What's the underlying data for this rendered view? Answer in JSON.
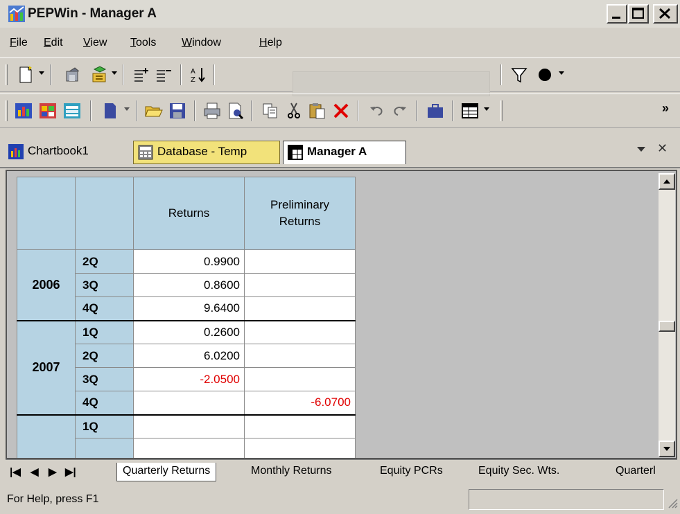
{
  "window": {
    "title": "PEPWin - Manager A",
    "buttons": [
      "minimize",
      "maximize",
      "close"
    ]
  },
  "menu": [
    {
      "label": "File",
      "key": "F"
    },
    {
      "label": "Edit",
      "key": "E"
    },
    {
      "label": "View",
      "key": "V"
    },
    {
      "label": "Tools",
      "key": "T"
    },
    {
      "label": "Window",
      "key": "W"
    },
    {
      "label": "Help",
      "key": "H"
    }
  ],
  "toolbar1": {
    "icons": [
      "new-document-icon",
      "properties-icon",
      "database-icon",
      "add-rows-icon",
      "remove-rows-icon",
      "sort-icon",
      "filter-icon",
      "circle-icon"
    ],
    "formula_value": ""
  },
  "toolbar2": {
    "icons": [
      "chart-icon",
      "chart-multi-icon",
      "chart-table-icon",
      "document-icon",
      "open-folder-icon",
      "save-icon",
      "print-icon",
      "print-preview-icon",
      "copy-icon",
      "cut-icon",
      "paste-icon",
      "delete-icon",
      "undo-icon",
      "redo-icon",
      "briefcase-icon",
      "table-icon"
    ],
    "overflow": "»"
  },
  "tabs": {
    "chartbook": "Chartbook1",
    "database": "Database - Temp",
    "manager": "Manager A"
  },
  "grid": {
    "headers": [
      "Returns",
      "Preliminary Returns"
    ],
    "header_line1": "Preliminary",
    "header_line2": "Returns",
    "rows": [
      {
        "year": "2006",
        "quarter": "2Q",
        "returns": "0.9900",
        "prelim": ""
      },
      {
        "year": "",
        "quarter": "3Q",
        "returns": "0.8600",
        "prelim": ""
      },
      {
        "year": "",
        "quarter": "4Q",
        "returns": "9.6400",
        "prelim": ""
      },
      {
        "year": "2007",
        "quarter": "1Q",
        "returns": "0.2600",
        "prelim": ""
      },
      {
        "year": "",
        "quarter": "2Q",
        "returns": "6.0200",
        "prelim": ""
      },
      {
        "year": "",
        "quarter": "3Q",
        "returns": "-2.0500",
        "prelim": ""
      },
      {
        "year": "",
        "quarter": "4Q",
        "returns": "",
        "prelim": "-6.0700"
      },
      {
        "year": "",
        "quarter": "1Q",
        "returns": "",
        "prelim": ""
      }
    ]
  },
  "sheets": {
    "active": "Quarterly Returns",
    "others": [
      "Monthly Returns",
      "Equity PCRs",
      "Equity Sec. Wts.",
      "Quarterl"
    ]
  },
  "status": {
    "text": "For Help, press F1"
  },
  "colors": {
    "header_bg": "#b6d3e3",
    "negative": "#e00000",
    "database_tab": "#f2e27a"
  }
}
